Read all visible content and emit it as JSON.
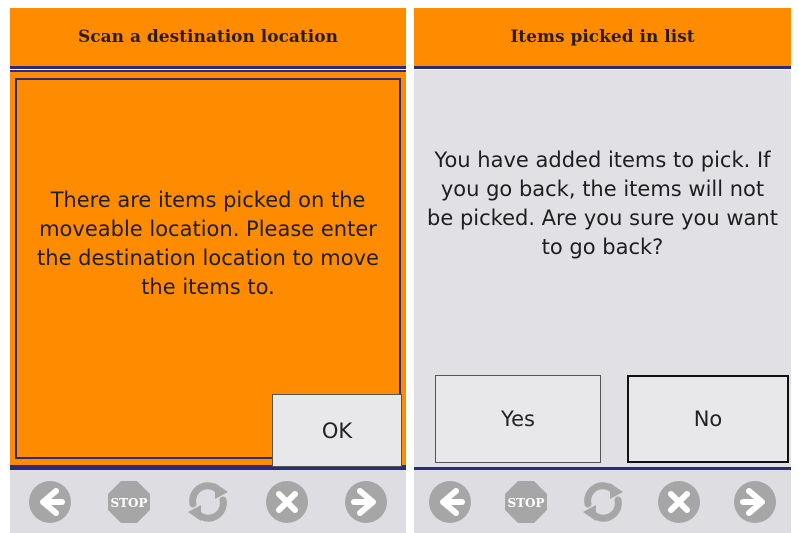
{
  "left_screen": {
    "title": "Scan a destination location",
    "message": "There are items picked on the moveable location. Please enter the destination location to move the items to.",
    "ok_label": "OK"
  },
  "right_screen": {
    "title": "Items picked in list",
    "message": "You have added items to pick. If you go back, the items will not be picked. Are you sure you want to go back?",
    "yes_label": "Yes",
    "no_label": "No"
  },
  "toolbar": {
    "icons": [
      "back-arrow-icon",
      "stop-icon",
      "refresh-icon",
      "cancel-icon",
      "forward-arrow-icon"
    ],
    "stop_label": "STOP"
  },
  "colors": {
    "accent": "#ff8c00",
    "border": "#2b2d7c",
    "panel": "#e1e0e5",
    "toolbar": "#dddde2",
    "icon_gray": "#a6a6a6"
  }
}
